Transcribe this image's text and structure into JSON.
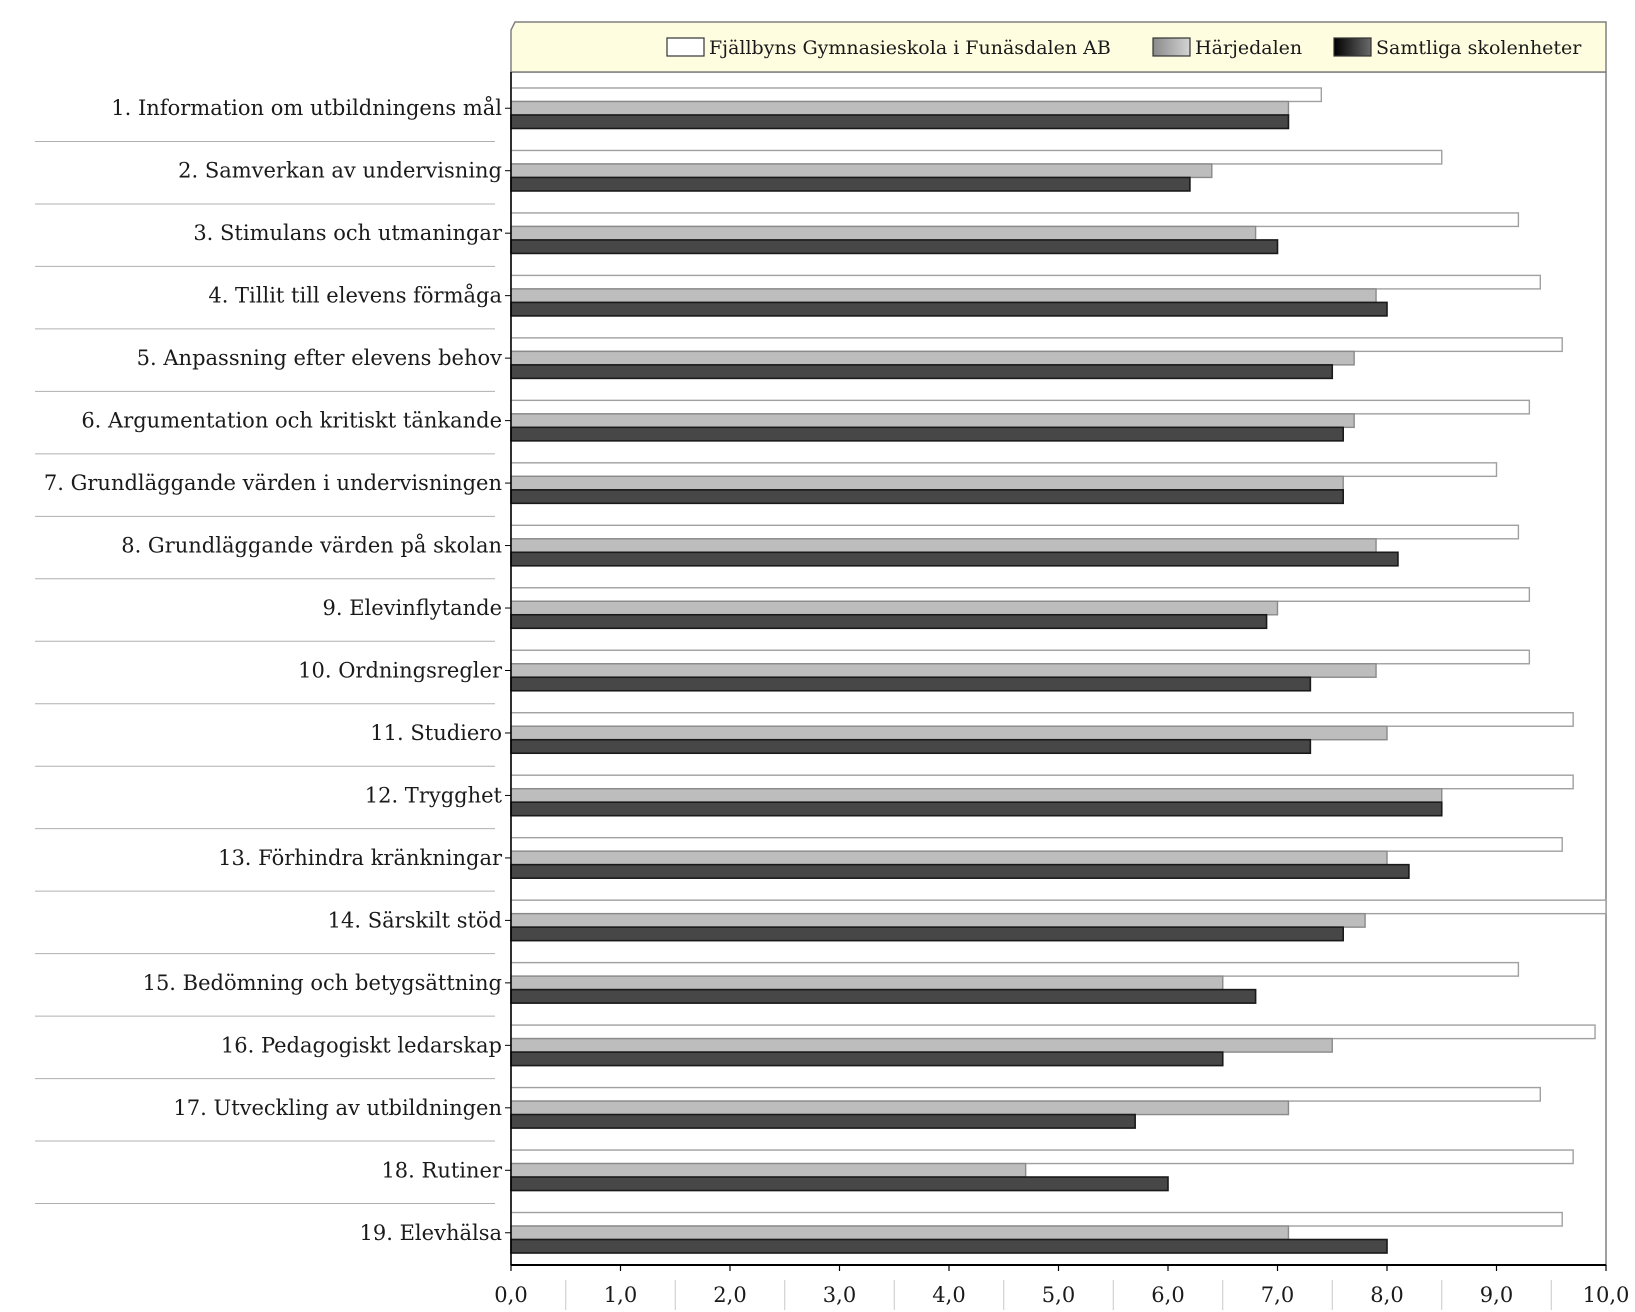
{
  "chart_data": {
    "type": "bar",
    "orientation": "horizontal",
    "title": "",
    "xlabel": "",
    "ylabel": "",
    "xlim": [
      0,
      10
    ],
    "x_ticks": [
      "0,0",
      "1,0",
      "2,0",
      "3,0",
      "4,0",
      "5,0",
      "6,0",
      "7,0",
      "8,0",
      "9,0",
      "10,0"
    ],
    "grid": false,
    "legend_position": "top",
    "categories": [
      "1. Information om utbildningens mål",
      "2. Samverkan av undervisning",
      "3. Stimulans och utmaningar",
      "4. Tillit till elevens förmåga",
      "5. Anpassning efter elevens behov",
      "6. Argumentation och kritiskt tänkande",
      "7. Grundläggande värden i undervisningen",
      "8. Grundläggande värden på skolan",
      "9. Elevinflytande",
      "10. Ordningsregler",
      "11. Studiero",
      "12. Trygghet",
      "13. Förhindra kränkningar",
      "14. Särskilt stöd",
      "15. Bedömning och betygsättning",
      "16. Pedagogiskt ledarskap",
      "17. Utveckling av utbildningen",
      "18. Rutiner",
      "19. Elevhälsa"
    ],
    "series": [
      {
        "name": "Fjällbyns Gymnasieskola i Funäsdalen AB",
        "color": "#ffffff",
        "stroke": "#a0a0a0",
        "values": [
          7.4,
          8.5,
          9.2,
          9.4,
          9.6,
          9.3,
          9.0,
          9.2,
          9.3,
          9.3,
          9.7,
          9.7,
          9.6,
          10.0,
          9.2,
          9.9,
          9.4,
          9.7,
          9.6
        ]
      },
      {
        "name": "Härjedalen",
        "color": "#bdbdbd",
        "stroke": "#8a8a8a",
        "values": [
          7.1,
          6.4,
          6.8,
          7.9,
          7.7,
          7.7,
          7.6,
          7.9,
          7.0,
          7.9,
          8.0,
          8.5,
          8.0,
          7.8,
          6.5,
          7.5,
          7.1,
          4.7,
          7.1
        ]
      },
      {
        "name": "Samtliga skolenheter",
        "color": "#474747",
        "stroke": "#1a1a1a",
        "values": [
          7.1,
          6.2,
          7.0,
          8.0,
          7.5,
          7.6,
          7.6,
          8.1,
          6.9,
          7.3,
          7.3,
          8.5,
          8.2,
          7.6,
          6.8,
          6.5,
          5.7,
          6.0,
          8.0
        ]
      }
    ]
  },
  "legend": {
    "background": "#fefde0",
    "items": [
      {
        "label": "Fjällbyns Gymnasieskola i Funäsdalen AB"
      },
      {
        "label": "Härjedalen"
      },
      {
        "label": "Samtliga skolenheter"
      }
    ]
  }
}
